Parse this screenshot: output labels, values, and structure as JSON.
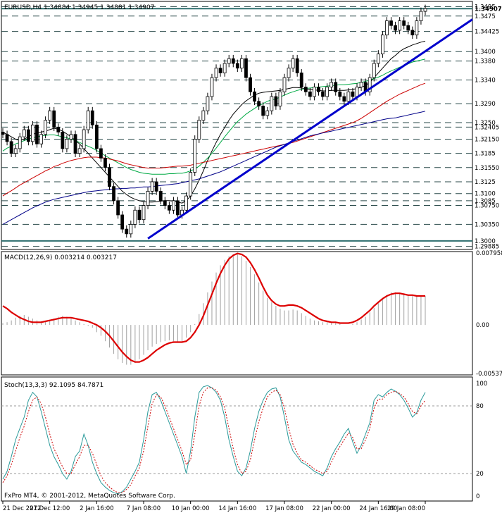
{
  "chart_data": [
    {
      "type": "line",
      "panel": "price",
      "title": "EURUSD,H4  1.34884 1.34945 1.34881 1.34907",
      "symbol": "EURUSD",
      "timeframe": "H4",
      "ohlc": {
        "open": 1.34884,
        "high": 1.34945,
        "low": 1.34881,
        "close": 1.34907
      },
      "ylim": [
        1.2985,
        1.3503
      ],
      "price_levels": [
        1.3495,
        1.3475,
        1.34425,
        1.34,
        1.338,
        1.334,
        1.329,
        1.325,
        1.32405,
        1.3215,
        1.3185,
        1.3155,
        1.3125,
        1.31,
        1.3085,
        1.3075,
        1.3035,
        1.3,
        1.29885
      ],
      "highlighted_levels": [
        1.34907,
        1.3
      ],
      "trendline": {
        "from": [
          34,
          1.3005
        ],
        "to": [
          100,
          1.3468
        ],
        "color": "#0000cc"
      },
      "x_labels": [
        "21 Dec 2012",
        "27 Dec 12:00",
        "2 Jan 16:00",
        "7 Jan 08:00",
        "10 Jan 00:00",
        "14 Jan 16:00",
        "17 Jan 08:00",
        "22 Jan 00:00",
        "24 Jan 16:00",
        "29 Jan 08:00"
      ],
      "close": [
        1.3225,
        1.321,
        1.3185,
        1.3195,
        1.322,
        1.3235,
        1.321,
        1.3245,
        1.3205,
        1.3225,
        1.3255,
        1.3275,
        1.324,
        1.323,
        1.3195,
        1.3215,
        1.3225,
        1.3185,
        1.3195,
        1.3235,
        1.3275,
        1.3245,
        1.3195,
        1.3175,
        1.3155,
        1.3115,
        1.3085,
        1.3055,
        1.3025,
        1.3015,
        1.3035,
        1.3065,
        1.3045,
        1.3075,
        1.3105,
        1.3125,
        1.3105,
        1.3085,
        1.3075,
        1.3065,
        1.3085,
        1.3055,
        1.3065,
        1.3095,
        1.3145,
        1.3215,
        1.3255,
        1.3275,
        1.3305,
        1.3345,
        1.3365,
        1.3355,
        1.3375,
        1.3385,
        1.3375,
        1.3365,
        1.3385,
        1.3345,
        1.3315,
        1.3295,
        1.3285,
        1.3265,
        1.3275,
        1.3305,
        1.3285,
        1.3315,
        1.3345,
        1.3365,
        1.3385,
        1.3355,
        1.3325,
        1.3315,
        1.3305,
        1.3325,
        1.3315,
        1.3305,
        1.3325,
        1.3335,
        1.3315,
        1.3305,
        1.3295,
        1.3315,
        1.3305,
        1.3325,
        1.3335,
        1.3315,
        1.3345,
        1.3375,
        1.3395,
        1.3435,
        1.3465,
        1.3455,
        1.3445,
        1.3465,
        1.3455,
        1.3445,
        1.3435,
        1.3465,
        1.3485,
        1.3491
      ],
      "ma_series": [
        {
          "color": "#000000",
          "values": [
            1.323,
            1.3225,
            1.322,
            1.3215,
            1.3212,
            1.3215,
            1.322,
            1.3225,
            1.3228,
            1.323,
            1.3232,
            1.3235,
            1.3238,
            1.3236,
            1.3232,
            1.3226,
            1.322,
            1.3212,
            1.3205,
            1.3195,
            1.3185,
            1.3175,
            1.3165,
            1.3155,
            1.3145,
            1.3135,
            1.3125,
            1.3115,
            1.3105,
            1.3098,
            1.3092,
            1.3088,
            1.3085,
            1.3083,
            1.3082,
            1.3082,
            1.3083,
            1.3084,
            1.3085,
            1.3085,
            1.3084,
            1.3082,
            1.308,
            1.3085,
            1.3095,
            1.311,
            1.3128,
            1.3148,
            1.317,
            1.319,
            1.3208,
            1.3225,
            1.324,
            1.3255,
            1.3268,
            1.3278,
            1.3288,
            1.3296,
            1.3302,
            1.3308,
            1.3312,
            1.3314,
            1.3315,
            1.3316,
            1.3317,
            1.3318,
            1.332,
            1.3322,
            1.3324,
            1.3324,
            1.3323,
            1.3321,
            1.332,
            1.3319,
            1.3318,
            1.3317,
            1.3317,
            1.3318,
            1.3318,
            1.3318,
            1.3318,
            1.3319,
            1.332,
            1.3322,
            1.3325,
            1.3328,
            1.3335,
            1.3345,
            1.3355,
            1.3365,
            1.3375,
            1.3385,
            1.3392,
            1.34,
            1.3406,
            1.341,
            1.3414,
            1.3417,
            1.342,
            1.3422
          ]
        },
        {
          "color": "#00aa44",
          "values": [
            1.319,
            1.3196,
            1.32,
            1.3205,
            1.3208,
            1.3212,
            1.3215,
            1.3218,
            1.322,
            1.3222,
            1.3223,
            1.3224,
            1.3224,
            1.3222,
            1.322,
            1.3218,
            1.3215,
            1.3212,
            1.3208,
            1.3204,
            1.32,
            1.3196,
            1.3191,
            1.3186,
            1.318,
            1.3175,
            1.317,
            1.3165,
            1.316,
            1.3155,
            1.3151,
            1.3148,
            1.3145,
            1.3143,
            1.3142,
            1.3141,
            1.3141,
            1.3141,
            1.3141,
            1.3142,
            1.3142,
            1.3143,
            1.3143,
            1.3145,
            1.3148,
            1.3152,
            1.3158,
            1.3166,
            1.3175,
            1.3185,
            1.3196,
            1.3208,
            1.322,
            1.3231,
            1.3242,
            1.3252,
            1.326,
            1.3268,
            1.3274,
            1.328,
            1.3286,
            1.329,
            1.3295,
            1.3298,
            1.33,
            1.3304,
            1.3308,
            1.3312,
            1.3315,
            1.3318,
            1.332,
            1.3322,
            1.3323,
            1.3324,
            1.3325,
            1.3326,
            1.3327,
            1.3328,
            1.3329,
            1.333,
            1.333,
            1.3331,
            1.3332,
            1.3333,
            1.3335,
            1.3337,
            1.334,
            1.3343,
            1.3346,
            1.335,
            1.3355,
            1.3359,
            1.3363,
            1.3367,
            1.337,
            1.3374,
            1.3378,
            1.338,
            1.3382,
            1.3384
          ]
        },
        {
          "color": "#cc0000",
          "values": [
            1.3095,
            1.3101,
            1.3106,
            1.3112,
            1.3118,
            1.3123,
            1.3128,
            1.3133,
            1.3138,
            1.3143,
            1.3148,
            1.3152,
            1.3157,
            1.316,
            1.3164,
            1.3167,
            1.317,
            1.3172,
            1.3174,
            1.3176,
            1.3177,
            1.3177,
            1.3177,
            1.3176,
            1.3175,
            1.3173,
            1.3171,
            1.3169,
            1.3166,
            1.3163,
            1.3161,
            1.3159,
            1.3157,
            1.3155,
            1.3154,
            1.3154,
            1.3154,
            1.3154,
            1.3155,
            1.3156,
            1.3157,
            1.3158,
            1.3158,
            1.3159,
            1.316,
            1.3162,
            1.3164,
            1.3166,
            1.3168,
            1.317,
            1.3172,
            1.3174,
            1.3176,
            1.3178,
            1.318,
            1.3182,
            1.3184,
            1.3186,
            1.3188,
            1.319,
            1.3192,
            1.3194,
            1.3196,
            1.3198,
            1.32,
            1.3202,
            1.3204,
            1.3206,
            1.3208,
            1.3211,
            1.3214,
            1.3217,
            1.322,
            1.3223,
            1.3226,
            1.3229,
            1.3232,
            1.3235,
            1.3238,
            1.3241,
            1.3244,
            1.3247,
            1.325,
            1.3254,
            1.3259,
            1.3265,
            1.3271,
            1.3277,
            1.3283,
            1.3289,
            1.3295,
            1.33,
            1.3305,
            1.331,
            1.3314,
            1.3318,
            1.3322,
            1.3326,
            1.333,
            1.3333
          ]
        },
        {
          "color": "#000088",
          "values": [
            1.3035,
            1.304,
            1.3045,
            1.305,
            1.3055,
            1.306,
            1.3065,
            1.307,
            1.3074,
            1.3078,
            1.3082,
            1.3085,
            1.3088,
            1.309,
            1.3092,
            1.3094,
            1.3096,
            1.3098,
            1.31,
            1.3102,
            1.3104,
            1.3105,
            1.3106,
            1.3107,
            1.3108,
            1.3109,
            1.311,
            1.311,
            1.3111,
            1.3111,
            1.3112,
            1.3112,
            1.3113,
            1.3114,
            1.3114,
            1.3115,
            1.3116,
            1.3117,
            1.3118,
            1.3119,
            1.312,
            1.3121,
            1.3123,
            1.3125,
            1.3127,
            1.3129,
            1.3131,
            1.3134,
            1.3137,
            1.314,
            1.3143,
            1.3146,
            1.315,
            1.3154,
            1.3158,
            1.3162,
            1.3166,
            1.317,
            1.3174,
            1.3178,
            1.3182,
            1.3186,
            1.319,
            1.3194,
            1.3198,
            1.3201,
            1.3204,
            1.3207,
            1.321,
            1.3213,
            1.3216,
            1.3219,
            1.3222,
            1.3224,
            1.3226,
            1.3228,
            1.323,
            1.3232,
            1.3234,
            1.3236,
            1.3238,
            1.324,
            1.3242,
            1.3244,
            1.3246,
            1.3248,
            1.325,
            1.3252,
            1.3254,
            1.3256,
            1.3258,
            1.3259,
            1.326,
            1.3262,
            1.3264,
            1.3266,
            1.3268,
            1.327,
            1.3272,
            1.3274
          ]
        }
      ]
    },
    {
      "type": "bar",
      "panel": "macd",
      "title": "MACD(12,26,9) 0.003214 0.003217",
      "ylim": [
        -0.00537,
        0.007958
      ],
      "y_ticks": [
        0.007958,
        0.0,
        -0.00537
      ],
      "signal_color": "#dd0000",
      "histogram": [
        0.0002,
        0.0003,
        0.0005,
        0.0008,
        0.001,
        0.0011,
        0.0009,
        0.0007,
        0.0005,
        0.0004,
        0.0004,
        0.0005,
        0.0007,
        0.0009,
        0.001,
        0.0009,
        0.0007,
        0.0005,
        0.0003,
        0.0001,
        -0.0001,
        -0.0003,
        -0.0008,
        -0.0012,
        -0.0018,
        -0.0025,
        -0.0032,
        -0.0038,
        -0.0042,
        -0.0044,
        -0.0044,
        -0.0042,
        -0.0038,
        -0.0033,
        -0.0028,
        -0.0024,
        -0.0021,
        -0.0019,
        -0.0018,
        -0.0017,
        -0.0018,
        -0.0019,
        -0.0018,
        -0.0014,
        -0.0008,
        0.0001,
        0.0012,
        0.0024,
        0.0036,
        0.0048,
        0.0058,
        0.0066,
        0.0072,
        0.0076,
        0.0078,
        0.0079,
        0.0076,
        0.0071,
        0.0064,
        0.0056,
        0.0047,
        0.0038,
        0.003,
        0.0025,
        0.0021,
        0.0018,
        0.0016,
        0.0016,
        0.0017,
        0.0016,
        0.0013,
        0.001,
        0.0007,
        0.0005,
        0.0004,
        0.0003,
        0.0003,
        0.0003,
        0.0002,
        0.0001,
        0.0,
        0.0,
        0.0001,
        0.0003,
        0.0006,
        0.0009,
        0.0014,
        0.0019,
        0.0024,
        0.0029,
        0.0033,
        0.0036,
        0.0036,
        0.0035,
        0.0034,
        0.0033,
        0.0032,
        0.0032,
        0.0032,
        0.0032
      ],
      "signal": [
        0.0021,
        0.0018,
        0.0014,
        0.0011,
        0.0008,
        0.0006,
        0.0004,
        0.0003,
        0.0003,
        0.0003,
        0.0004,
        0.0005,
        0.0006,
        0.0007,
        0.0008,
        0.0008,
        0.0008,
        0.0007,
        0.0006,
        0.0005,
        0.0004,
        0.0002,
        0.0,
        -0.0003,
        -0.0007,
        -0.0012,
        -0.0018,
        -0.0024,
        -0.003,
        -0.0035,
        -0.0039,
        -0.0041,
        -0.0041,
        -0.0039,
        -0.0036,
        -0.0032,
        -0.0028,
        -0.0025,
        -0.0022,
        -0.002,
        -0.0019,
        -0.0019,
        -0.0019,
        -0.0018,
        -0.0014,
        -0.0008,
        0.0,
        0.001,
        0.0022,
        0.0034,
        0.0046,
        0.0057,
        0.0066,
        0.0073,
        0.0077,
        0.0079,
        0.0078,
        0.0075,
        0.0069,
        0.0061,
        0.0052,
        0.0042,
        0.0033,
        0.0027,
        0.0023,
        0.0021,
        0.0021,
        0.0022,
        0.0022,
        0.0021,
        0.0019,
        0.0016,
        0.0013,
        0.001,
        0.0007,
        0.0005,
        0.0004,
        0.0003,
        0.0003,
        0.0002,
        0.0002,
        0.0002,
        0.0003,
        0.0005,
        0.0008,
        0.0012,
        0.0016,
        0.0021,
        0.0025,
        0.0029,
        0.0032,
        0.0034,
        0.0035,
        0.0035,
        0.0034,
        0.0033,
        0.0033,
        0.0032,
        0.0032,
        0.0032
      ]
    },
    {
      "type": "line",
      "panel": "stochastic",
      "title": "Stoch(13,3,3) 92.1095 84.7871",
      "ylim": [
        0,
        100
      ],
      "y_ticks": [
        100,
        80,
        20,
        0
      ],
      "series": [
        {
          "color": "#2a9a9a",
          "values": [
            15,
            22,
            35,
            50,
            60,
            70,
            85,
            92,
            88,
            75,
            60,
            45,
            35,
            28,
            20,
            15,
            22,
            35,
            40,
            55,
            45,
            30,
            20,
            12,
            8,
            5,
            3,
            2,
            4,
            8,
            15,
            22,
            30,
            50,
            75,
            90,
            92,
            85,
            75,
            65,
            55,
            45,
            35,
            20,
            40,
            70,
            92,
            97,
            98,
            96,
            92,
            85,
            70,
            50,
            35,
            22,
            18,
            25,
            40,
            60,
            75,
            85,
            92,
            95,
            96,
            88,
            70,
            50,
            40,
            35,
            30,
            28,
            25,
            22,
            20,
            18,
            25,
            35,
            42,
            48,
            55,
            60,
            48,
            38,
            45,
            55,
            65,
            85,
            90,
            88,
            92,
            95,
            93,
            90,
            85,
            78,
            70,
            74,
            85,
            92
          ]
        },
        {
          "color": "#cc0000",
          "values": [
            12,
            18,
            28,
            40,
            52,
            62,
            75,
            85,
            88,
            82,
            70,
            55,
            42,
            34,
            26,
            20,
            20,
            28,
            35,
            45,
            45,
            38,
            28,
            18,
            12,
            8,
            5,
            3,
            3,
            6,
            10,
            18,
            25,
            40,
            62,
            82,
            90,
            88,
            80,
            70,
            60,
            50,
            40,
            28,
            32,
            55,
            80,
            92,
            96,
            96,
            94,
            88,
            78,
            60,
            42,
            28,
            20,
            22,
            32,
            50,
            66,
            78,
            88,
            92,
            94,
            90,
            78,
            60,
            46,
            38,
            32,
            30,
            27,
            24,
            22,
            20,
            22,
            30,
            38,
            44,
            50,
            56,
            52,
            42,
            42,
            50,
            60,
            78,
            86,
            86,
            90,
            92,
            93,
            91,
            88,
            82,
            75,
            73,
            80,
            85
          ]
        }
      ]
    }
  ],
  "footer": "FxPro MT4, © 2001-2012, MetaQuotes Software Corp."
}
